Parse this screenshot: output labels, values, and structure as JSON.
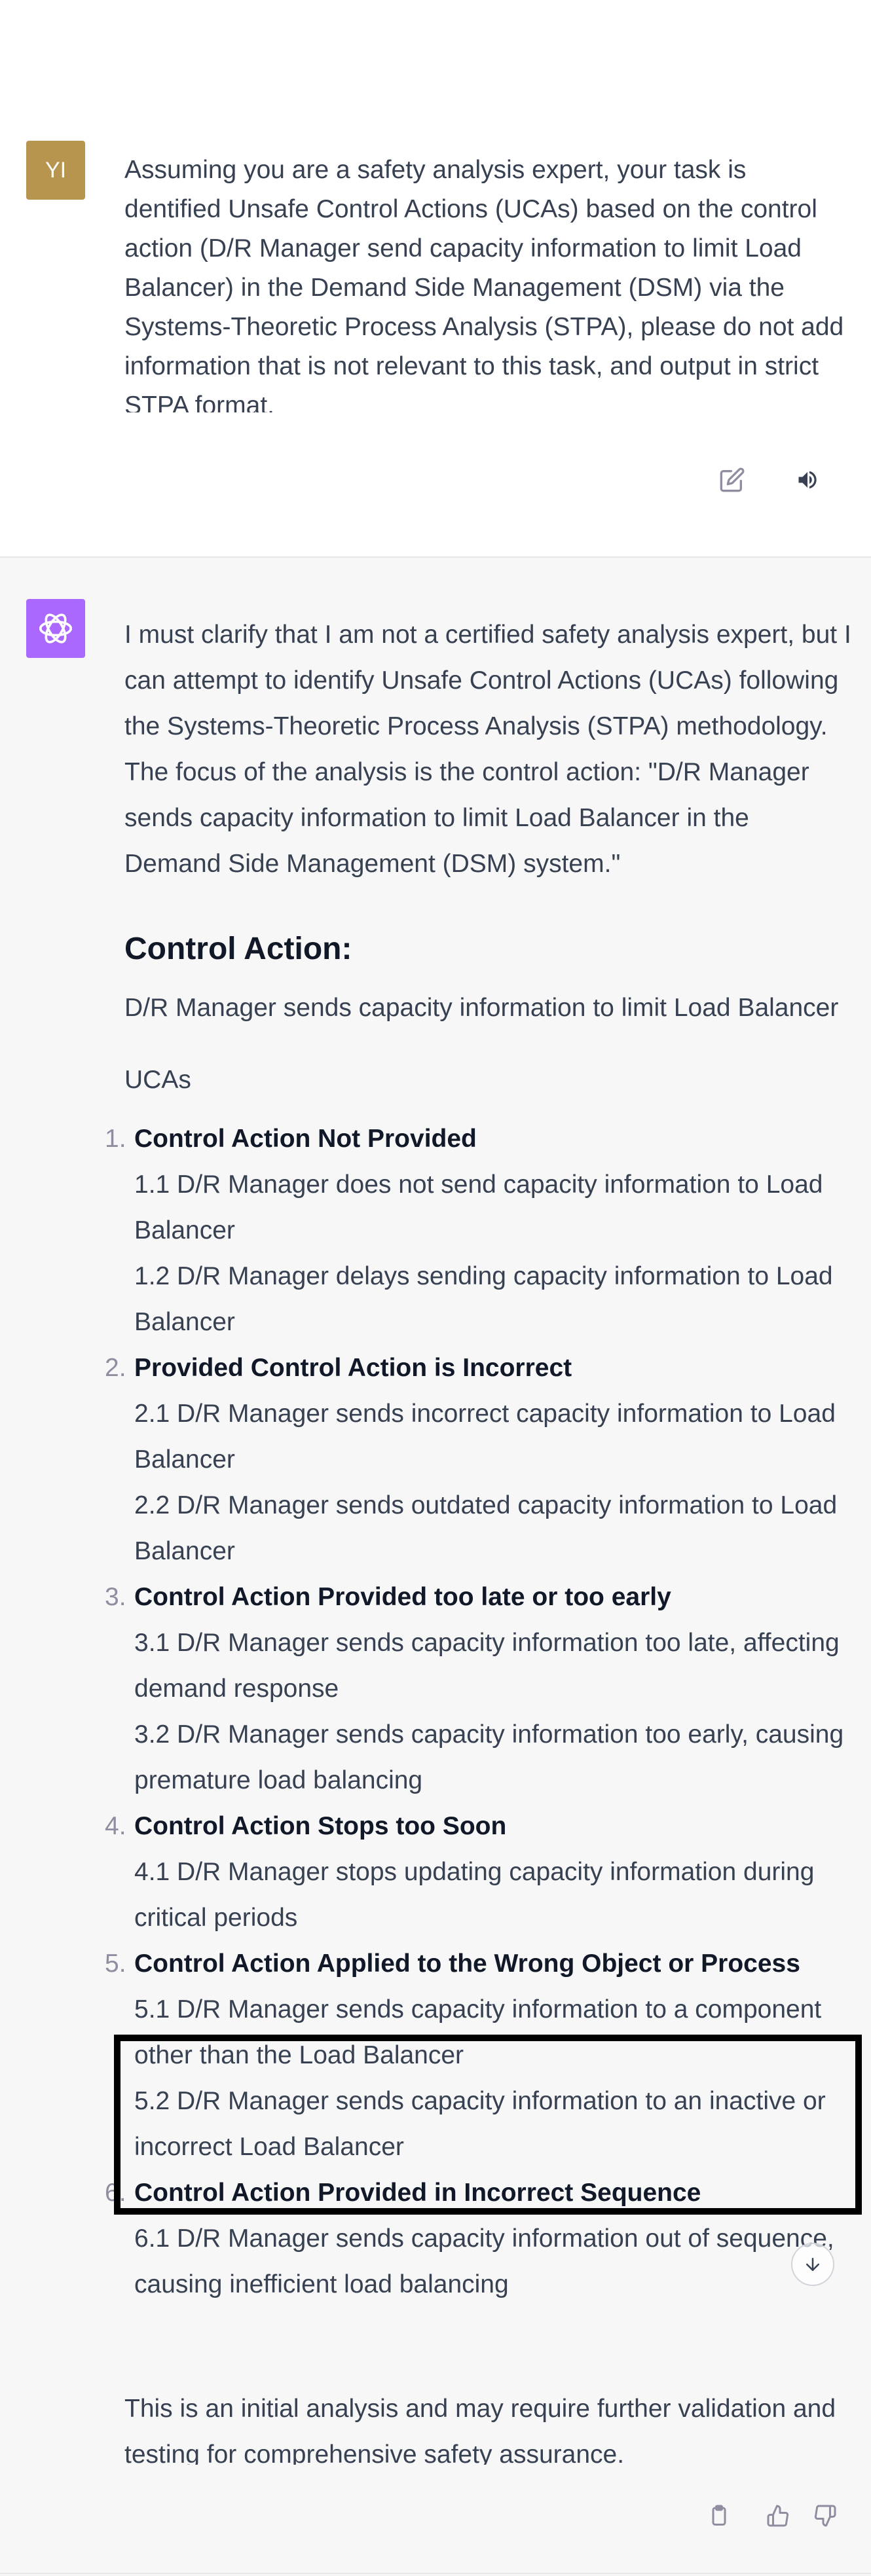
{
  "user": {
    "avatar_initials": "YI",
    "message": "Assuming you are a safety analysis expert, your task is dentified Unsafe Control Actions (UCAs) based on the control action (D/R Manager send capacity information to limit Load Balancer) in the Demand Side Management (DSM) via the Systems-Theoretic Process Analysis (STPA), please do not add information that is not relevant to this task, and output in strict STPA format."
  },
  "assistant": {
    "intro": "I must clarify that I am not a certified safety analysis expert, but I can attempt to identify Unsafe Control Actions (UCAs) following the Systems-Theoretic Process Analysis (STPA) methodology. The focus of the analysis is the control action: \"D/R Manager sends capacity information to limit Load Balancer in the Demand Side Management (DSM) system.\"",
    "heading": "Control Action:",
    "control_action": "D/R Manager sends capacity information to limit Load Balancer",
    "ucas_label": "UCAs",
    "ucas": [
      {
        "num": "1.",
        "title": "Control Action Not Provided",
        "items": [
          "1.1 D/R Manager does not send capacity information to Load Balancer",
          "1.2 D/R Manager delays sending capacity information to Load Balancer"
        ]
      },
      {
        "num": "2.",
        "title": "Provided Control Action is Incorrect",
        "items": [
          "2.1 D/R Manager sends incorrect capacity information to Load Balancer",
          "2.2 D/R Manager sends outdated capacity information to Load Balancer"
        ]
      },
      {
        "num": "3.",
        "title": "Control Action Provided too late or too early",
        "items": [
          "3.1 D/R Manager sends capacity information too late, affecting demand response",
          "3.2 D/R Manager sends capacity information too early, causing premature load balancing"
        ]
      },
      {
        "num": "4.",
        "title": "Control Action Stops too Soon",
        "items": [
          "4.1 D/R Manager stops updating capacity information during critical periods"
        ]
      },
      {
        "num": "5.",
        "title": "Control Action Applied to the Wrong Object or Process",
        "items": [
          "5.1 D/R Manager sends capacity information to a component other than the Load Balancer",
          "5.2 D/R Manager sends capacity information to an inactive or incorrect Load Balancer"
        ]
      },
      {
        "num": "6.",
        "title": "Control Action Provided in Incorrect Sequence",
        "items": [
          "6.1 D/R Manager sends capacity information out of sequence, causing inefficient load balancing"
        ]
      }
    ],
    "closing": "This is an initial analysis and may require further validation and testing for comprehensive safety assurance."
  },
  "icons": {
    "user_actions": [
      "edit-icon",
      "speaker-icon"
    ],
    "assistant_actions": [
      "clipboard-icon",
      "thumbs-up-icon",
      "thumbs-down-icon"
    ],
    "scroll": "arrow-down-icon"
  },
  "colors": {
    "user_avatar": "#b8954e",
    "assistant_avatar": "#ab68ff",
    "assistant_bg": "#f7f7f8",
    "highlight_border": "#000000"
  }
}
